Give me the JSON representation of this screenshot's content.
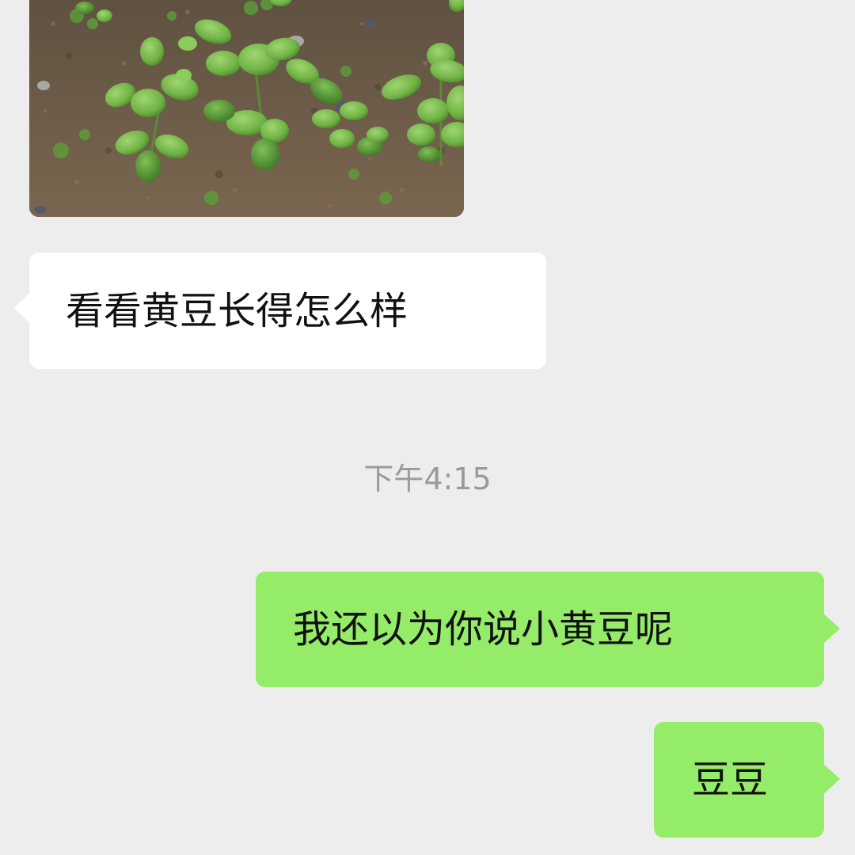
{
  "messages": [
    {
      "sender": "other",
      "type": "image",
      "description": "soybean seedlings"
    },
    {
      "sender": "other",
      "type": "text",
      "text": "看看黄豆长得怎么样"
    },
    {
      "type": "time",
      "text": "下午4:15"
    },
    {
      "sender": "self",
      "type": "text",
      "text": "我还以为你说小黄豆呢"
    },
    {
      "sender": "self",
      "type": "text",
      "text": "豆豆"
    }
  ],
  "colors": {
    "background": "#ededed",
    "incoming_bubble": "#ffffff",
    "outgoing_bubble": "#95ec69",
    "timestamp": "#9a9a9a"
  }
}
